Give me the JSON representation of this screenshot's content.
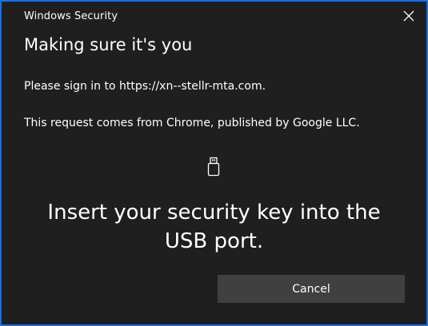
{
  "window": {
    "app_title": "Windows Security",
    "close_icon": "close-icon",
    "accent_border_color": "#1f6fd6",
    "background_color": "#1f1f1f"
  },
  "dialog": {
    "heading": "Making sure it's you",
    "signin_message": "Please sign in to https://xn--stellr-mta.com.",
    "request_message": "This request comes from Chrome, published by Google LLC.",
    "device_icon": "usb-key-icon",
    "instruction": "Insert your security key into the USB port."
  },
  "actions": {
    "cancel_label": "Cancel",
    "cancel_color": "#404040"
  }
}
